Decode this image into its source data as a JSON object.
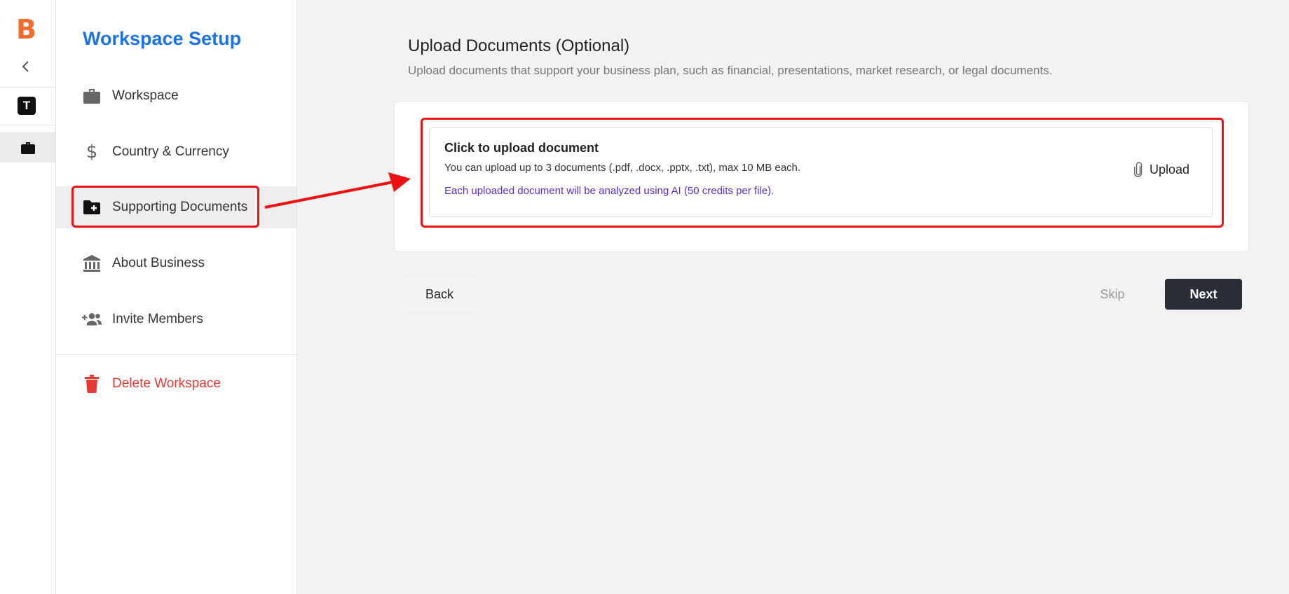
{
  "rail": {
    "logo": "B",
    "workspace_initial": "T",
    "icons": {
      "collapse": "chevron-left-icon",
      "active": "briefcase-icon"
    }
  },
  "sidebar": {
    "title": "Workspace Setup",
    "items": [
      {
        "label": "Workspace",
        "icon": "briefcase-icon"
      },
      {
        "label": "Country & Currency",
        "icon": "dollar-icon"
      },
      {
        "label": "Supporting Documents",
        "icon": "folder-plus-icon",
        "active": true
      },
      {
        "label": "About Business",
        "icon": "bank-icon"
      },
      {
        "label": "Invite Members",
        "icon": "add-people-icon"
      }
    ],
    "danger_item": {
      "label": "Delete Workspace",
      "icon": "trash-icon"
    }
  },
  "main": {
    "title": "Upload Documents (Optional)",
    "subtitle": "Upload documents that support your business plan, such as financial, presentations, market research, or legal documents.",
    "upload": {
      "title": "Click to upload document",
      "description": "You can upload up to 3 documents (.pdf, .docx, .pptx, .txt), max 10 MB each.",
      "note": "Each uploaded document will be analyzed using AI (50 credits per file).",
      "button_label": "Upload"
    },
    "buttons": {
      "back": "Back",
      "skip": "Skip",
      "next": "Next"
    }
  },
  "colors": {
    "brand": "#f26b2a",
    "title_blue": "#1a73e8",
    "note_purple": "#5b2ec7",
    "danger": "#e53935",
    "primary_button": "#2a2f37",
    "annotation": "#ee1111"
  }
}
